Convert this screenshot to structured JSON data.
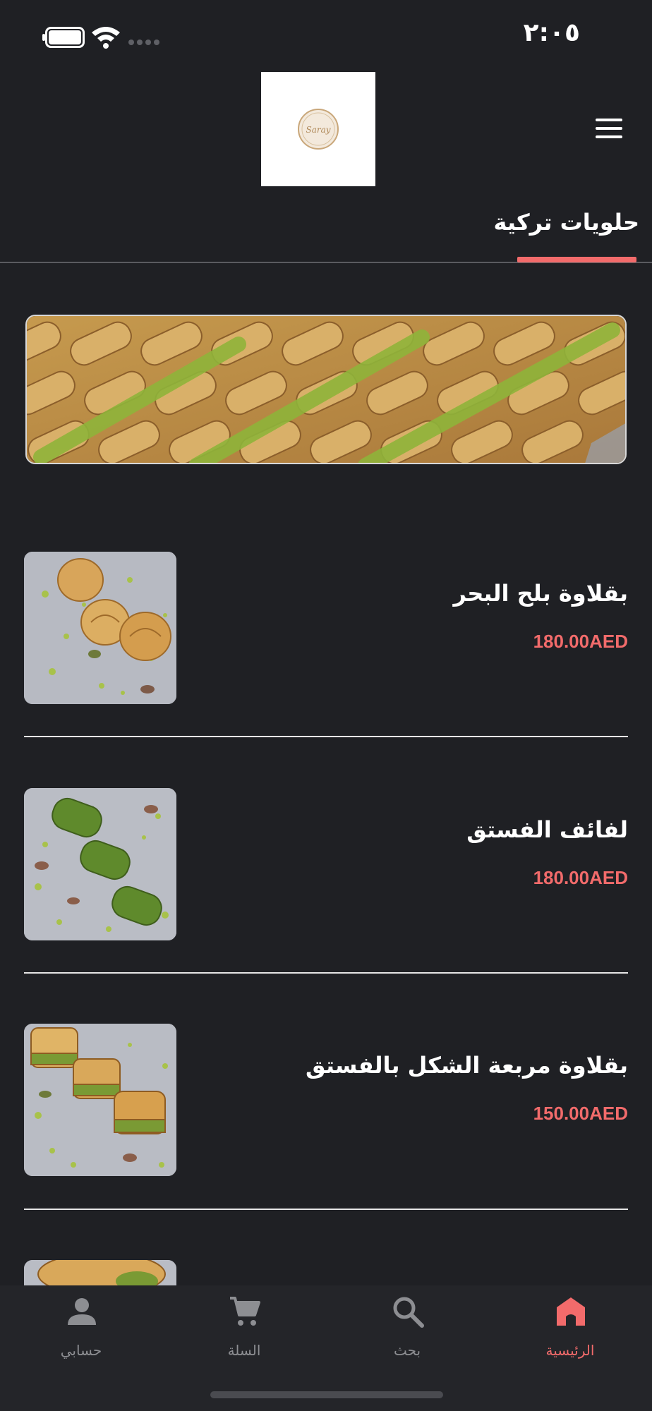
{
  "status_bar": {
    "time": "٢:٠٥"
  },
  "header": {
    "logo_text": "Saray"
  },
  "category": {
    "title": "حلويات تركية"
  },
  "products": [
    {
      "name": "بقلاوة بلح البحر",
      "price": "180.00AED"
    },
    {
      "name": "لفائف الفستق",
      "price": "180.00AED"
    },
    {
      "name": "بقلاوة مربعة الشكل بالفستق",
      "price": "150.00AED"
    }
  ],
  "bottom_nav": {
    "account": "حسابي",
    "cart": "السلة",
    "search": "بحث",
    "home": "الرئيسية"
  },
  "colors": {
    "background": "#1f2024",
    "accent": "#f26b6b",
    "nav_background": "#242529",
    "inactive": "#8d8e92"
  },
  "icons": [
    "battery-icon",
    "wifi-icon",
    "signal-icon",
    "menu-icon",
    "person-icon",
    "cart-icon",
    "search-icon",
    "home-icon"
  ]
}
